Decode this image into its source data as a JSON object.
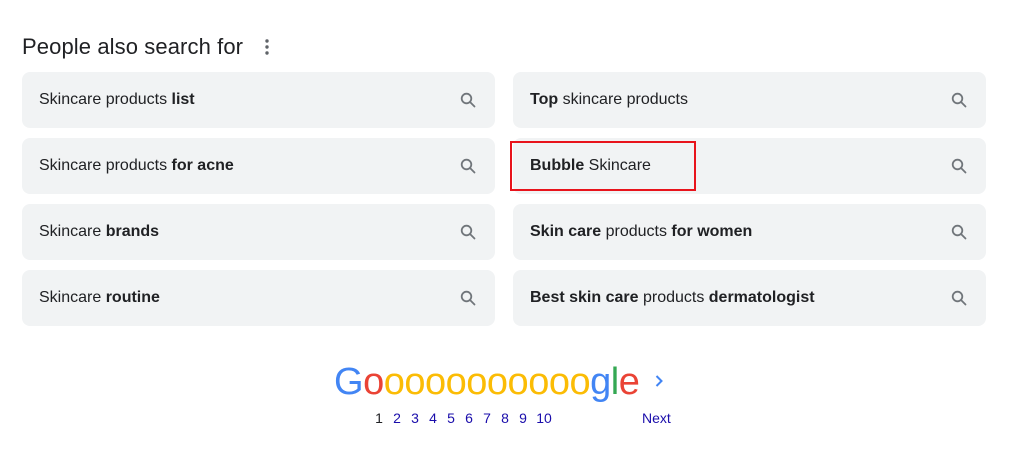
{
  "section": {
    "title": "People also search for",
    "more_icon": "more-vert-icon"
  },
  "suggestions": [
    {
      "parts": [
        {
          "t": "Skincare products ",
          "b": false
        },
        {
          "t": "list",
          "b": true
        }
      ]
    },
    {
      "parts": [
        {
          "t": "Top",
          "b": true
        },
        {
          "t": " skincare products",
          "b": false
        }
      ]
    },
    {
      "parts": [
        {
          "t": "Skincare products ",
          "b": false
        },
        {
          "t": "for acne",
          "b": true
        }
      ]
    },
    {
      "parts": [
        {
          "t": "Bubble",
          "b": true
        },
        {
          "t": " Skincare",
          "b": false
        }
      ],
      "highlighted": true
    },
    {
      "parts": [
        {
          "t": "Skincare ",
          "b": false
        },
        {
          "t": "brands",
          "b": true
        }
      ]
    },
    {
      "parts": [
        {
          "t": "Skin care",
          "b": true
        },
        {
          "t": " products ",
          "b": false
        },
        {
          "t": "for women",
          "b": true
        }
      ]
    },
    {
      "parts": [
        {
          "t": "Skincare ",
          "b": false
        },
        {
          "t": "routine",
          "b": true
        }
      ]
    },
    {
      "parts": [
        {
          "t": "Best skin care",
          "b": true
        },
        {
          "t": " products ",
          "b": false
        },
        {
          "t": "dermatologist",
          "b": true
        }
      ]
    }
  ],
  "pagination": {
    "logo_letters": [
      {
        "ch": "G",
        "color": "#4285f4"
      },
      {
        "ch": "o",
        "color": "#ea4335"
      },
      {
        "ch": "o",
        "color": "#fbbc05"
      },
      {
        "ch": "o",
        "color": "#fbbc05"
      },
      {
        "ch": "o",
        "color": "#fbbc05"
      },
      {
        "ch": "o",
        "color": "#fbbc05"
      },
      {
        "ch": "o",
        "color": "#fbbc05"
      },
      {
        "ch": "o",
        "color": "#fbbc05"
      },
      {
        "ch": "o",
        "color": "#fbbc05"
      },
      {
        "ch": "o",
        "color": "#fbbc05"
      },
      {
        "ch": "o",
        "color": "#fbbc05"
      },
      {
        "ch": "o",
        "color": "#fbbc05"
      },
      {
        "ch": "g",
        "color": "#4285f4"
      },
      {
        "ch": "l",
        "color": "#34a853"
      },
      {
        "ch": "e",
        "color": "#ea4335"
      }
    ],
    "pages": [
      "1",
      "2",
      "3",
      "4",
      "5",
      "6",
      "7",
      "8",
      "9",
      "10"
    ],
    "current_page": "1",
    "next_label": "Next",
    "next_icon": "chevron-right-icon"
  },
  "colors": {
    "chip_bg": "#f1f3f4",
    "link": "#1a0dab",
    "highlight_border": "#e8131b"
  }
}
